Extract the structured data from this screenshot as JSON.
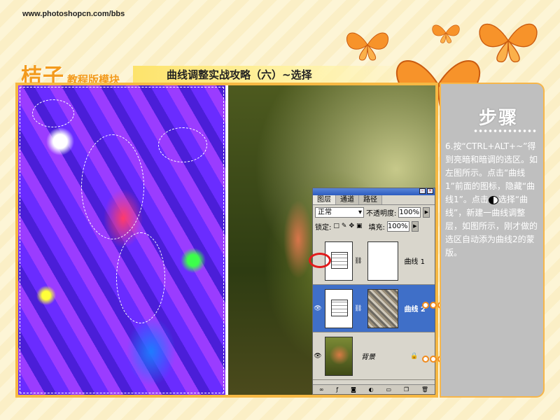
{
  "site": {
    "url": "www.photoshopcn.com/bbs"
  },
  "brand": {
    "logo": "桔子",
    "module": "教程版模块"
  },
  "page_title": "曲线调整实战攻略（六）~选择",
  "colors": {
    "accent_orange": "#f6b843",
    "selection_blue": "#3f6fc8",
    "annotation_red": "#e21b1b"
  },
  "sidebar": {
    "heading": "步骤",
    "step_before_icon": "6.按“CTRL+ALT+~”得到亮暗和暗调的选区。如左图所示。点击“曲线1”前面的图标，隐藏“曲线1”。点击",
    "step_after_icon": "选择“曲线”，新建一曲线调整层，如图所示，刚才做的选区自动添为曲线2的蒙版。",
    "inline_icon": "adjustment-layer-icon"
  },
  "layers_panel": {
    "tabs": [
      "图层",
      "通道",
      "路径"
    ],
    "blend_mode": "正常",
    "opacity_label": "不透明度:",
    "opacity_value": "100%",
    "lock_label": "锁定:",
    "fill_label": "填充:",
    "fill_value": "100%",
    "layers": [
      {
        "name": "曲线 1",
        "visible": false,
        "selected": false
      },
      {
        "name": "曲线 2",
        "visible": true,
        "selected": true
      },
      {
        "name": "背景",
        "visible": true,
        "selected": false
      }
    ]
  }
}
